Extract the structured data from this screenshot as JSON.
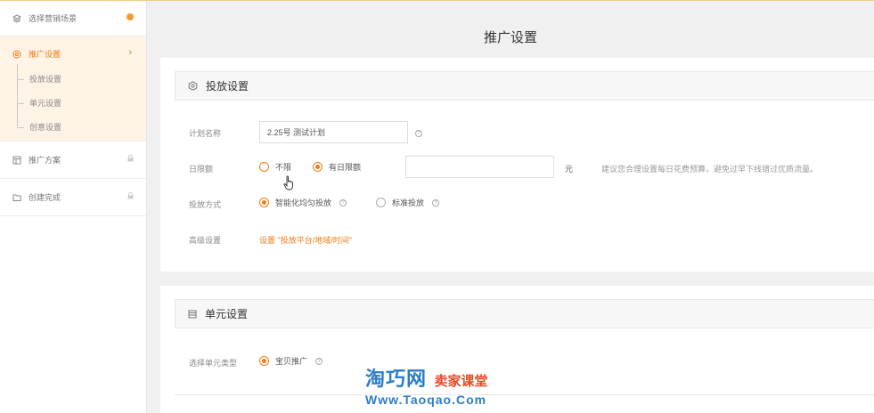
{
  "sidebar": {
    "step1": "选择营销场景",
    "step2": "推广设置",
    "subs": [
      "投放设置",
      "单元设置",
      "创意设置"
    ],
    "step3": "推广方案",
    "step4": "创建完成"
  },
  "page_title": "推广设置",
  "delivery": {
    "section_title": "投放设置",
    "plan_name_label": "计划名称",
    "plan_name_value": "2.25号 测试计划",
    "daily_limit_label": "日限额",
    "limit_none": "不限",
    "limit_has": "有日限额",
    "budget_value": "",
    "unit": "元",
    "budget_hint": "建议您合理设置每日花费预算，避免过早下线错过优质流量。",
    "method_label": "投放方式",
    "method_smart": "智能化均匀投放",
    "method_standard": "标准投放",
    "advanced_label": "高级设置",
    "advanced_link": "设置 \"投放平台/地域/时间\""
  },
  "unit": {
    "section_title": "单元设置",
    "type_label": "选择单元类型",
    "type_value": "宝贝推广"
  },
  "watermark": {
    "brand": "淘巧网",
    "sub": "卖家课堂",
    "url": "Www.Taoqao.Com"
  },
  "colors": {
    "accent": "#f07b14",
    "sidebar_active_bg": "#fff3e6",
    "watermark_blue": "#2b7ec9",
    "watermark_red": "#e24a24"
  }
}
